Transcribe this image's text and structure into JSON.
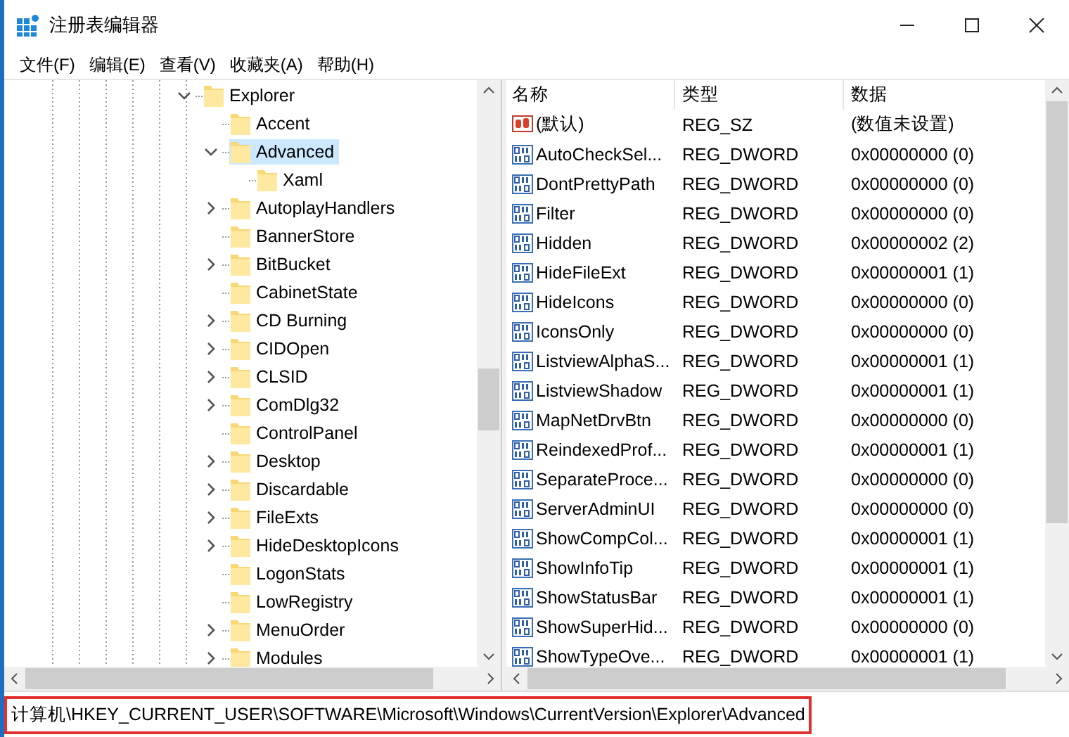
{
  "window": {
    "title": "注册表编辑器"
  },
  "menu": [
    "文件(F)",
    "编辑(E)",
    "查看(V)",
    "收藏夹(A)",
    "帮助(H)"
  ],
  "tree": [
    {
      "label": "Explorer",
      "expandable": true,
      "expanded": true,
      "selected": false,
      "children": [
        {
          "label": "Accent",
          "expandable": false,
          "expanded": false,
          "selected": false
        },
        {
          "label": "Advanced",
          "expandable": true,
          "expanded": true,
          "selected": true,
          "children": [
            {
              "label": "Xaml",
              "expandable": false,
              "expanded": false,
              "selected": false
            }
          ]
        },
        {
          "label": "AutoplayHandlers",
          "expandable": true,
          "expanded": false,
          "selected": false
        },
        {
          "label": "BannerStore",
          "expandable": false,
          "expanded": false,
          "selected": false
        },
        {
          "label": "BitBucket",
          "expandable": true,
          "expanded": false,
          "selected": false
        },
        {
          "label": "CabinetState",
          "expandable": false,
          "expanded": false,
          "selected": false
        },
        {
          "label": "CD Burning",
          "expandable": true,
          "expanded": false,
          "selected": false
        },
        {
          "label": "CIDOpen",
          "expandable": true,
          "expanded": false,
          "selected": false
        },
        {
          "label": "CLSID",
          "expandable": true,
          "expanded": false,
          "selected": false
        },
        {
          "label": "ComDlg32",
          "expandable": true,
          "expanded": false,
          "selected": false
        },
        {
          "label": "ControlPanel",
          "expandable": false,
          "expanded": false,
          "selected": false
        },
        {
          "label": "Desktop",
          "expandable": true,
          "expanded": false,
          "selected": false
        },
        {
          "label": "Discardable",
          "expandable": true,
          "expanded": false,
          "selected": false
        },
        {
          "label": "FileExts",
          "expandable": true,
          "expanded": false,
          "selected": false
        },
        {
          "label": "HideDesktopIcons",
          "expandable": true,
          "expanded": false,
          "selected": false
        },
        {
          "label": "LogonStats",
          "expandable": false,
          "expanded": false,
          "selected": false
        },
        {
          "label": "LowRegistry",
          "expandable": false,
          "expanded": false,
          "selected": false
        },
        {
          "label": "MenuOrder",
          "expandable": true,
          "expanded": false,
          "selected": false
        },
        {
          "label": "Modules",
          "expandable": true,
          "expanded": false,
          "selected": false
        }
      ]
    }
  ],
  "table": {
    "columns": [
      "名称",
      "类型",
      "数据"
    ],
    "rows": [
      {
        "kind": "string",
        "name": "(默认)",
        "type": "REG_SZ",
        "data": "(数值未设置)"
      },
      {
        "kind": "dword",
        "name": "AutoCheckSel...",
        "type": "REG_DWORD",
        "data": "0x00000000 (0)"
      },
      {
        "kind": "dword",
        "name": "DontPrettyPath",
        "type": "REG_DWORD",
        "data": "0x00000000 (0)"
      },
      {
        "kind": "dword",
        "name": "Filter",
        "type": "REG_DWORD",
        "data": "0x00000000 (0)"
      },
      {
        "kind": "dword",
        "name": "Hidden",
        "type": "REG_DWORD",
        "data": "0x00000002 (2)"
      },
      {
        "kind": "dword",
        "name": "HideFileExt",
        "type": "REG_DWORD",
        "data": "0x00000001 (1)"
      },
      {
        "kind": "dword",
        "name": "HideIcons",
        "type": "REG_DWORD",
        "data": "0x00000000 (0)"
      },
      {
        "kind": "dword",
        "name": "IconsOnly",
        "type": "REG_DWORD",
        "data": "0x00000000 (0)"
      },
      {
        "kind": "dword",
        "name": "ListviewAlphaS...",
        "type": "REG_DWORD",
        "data": "0x00000001 (1)"
      },
      {
        "kind": "dword",
        "name": "ListviewShadow",
        "type": "REG_DWORD",
        "data": "0x00000001 (1)"
      },
      {
        "kind": "dword",
        "name": "MapNetDrvBtn",
        "type": "REG_DWORD",
        "data": "0x00000000 (0)"
      },
      {
        "kind": "dword",
        "name": "ReindexedProf...",
        "type": "REG_DWORD",
        "data": "0x00000001 (1)"
      },
      {
        "kind": "dword",
        "name": "SeparateProce...",
        "type": "REG_DWORD",
        "data": "0x00000000 (0)"
      },
      {
        "kind": "dword",
        "name": "ServerAdminUI",
        "type": "REG_DWORD",
        "data": "0x00000000 (0)"
      },
      {
        "kind": "dword",
        "name": "ShowCompCol...",
        "type": "REG_DWORD",
        "data": "0x00000001 (1)"
      },
      {
        "kind": "dword",
        "name": "ShowInfoTip",
        "type": "REG_DWORD",
        "data": "0x00000001 (1)"
      },
      {
        "kind": "dword",
        "name": "ShowStatusBar",
        "type": "REG_DWORD",
        "data": "0x00000001 (1)"
      },
      {
        "kind": "dword",
        "name": "ShowSuperHid...",
        "type": "REG_DWORD",
        "data": "0x00000000 (0)"
      },
      {
        "kind": "dword",
        "name": "ShowTypeOve...",
        "type": "REG_DWORD",
        "data": "0x00000001 (1)"
      }
    ]
  },
  "status_bar": {
    "path": "计算机\\HKEY_CURRENT_USER\\SOFTWARE\\Microsoft\\Windows\\CurrentVersion\\Explorer\\Advanced"
  }
}
